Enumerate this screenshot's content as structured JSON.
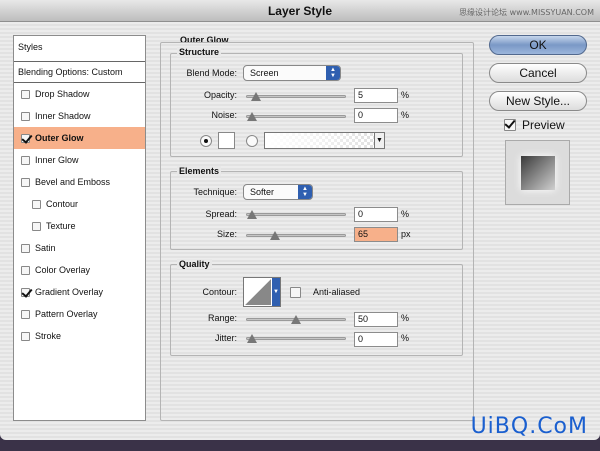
{
  "window": {
    "title": "Layer Style"
  },
  "watermark_top": "思缘设计论坛 www.MISSYUAN.COM",
  "watermark_bottom": "UiBQ.CoM",
  "sidebar": {
    "styles_label": "Styles",
    "blending_label": "Blending Options: Custom",
    "items": [
      {
        "label": "Drop Shadow",
        "checked": false
      },
      {
        "label": "Inner Shadow",
        "checked": false
      },
      {
        "label": "Outer Glow",
        "checked": true,
        "selected": true
      },
      {
        "label": "Inner Glow",
        "checked": false
      },
      {
        "label": "Bevel and Emboss",
        "checked": false
      },
      {
        "label": "Contour",
        "checked": false,
        "indent": true
      },
      {
        "label": "Texture",
        "checked": false,
        "indent": true
      },
      {
        "label": "Satin",
        "checked": false
      },
      {
        "label": "Color Overlay",
        "checked": false
      },
      {
        "label": "Gradient Overlay",
        "checked": true
      },
      {
        "label": "Pattern Overlay",
        "checked": false
      },
      {
        "label": "Stroke",
        "checked": false
      }
    ]
  },
  "panel": {
    "title": "Outer Glow",
    "structure": {
      "label": "Structure",
      "blend_mode_label": "Blend Mode:",
      "blend_mode_value": "Screen",
      "opacity_label": "Opacity:",
      "opacity_value": "5",
      "opacity_level": 0.05,
      "noise_label": "Noise:",
      "noise_value": "0",
      "noise_level": 0,
      "unit": "%"
    },
    "elements": {
      "label": "Elements",
      "technique_label": "Technique:",
      "technique_value": "Softer",
      "spread_label": "Spread:",
      "spread_value": "0",
      "spread_level": 0,
      "spread_unit": "%",
      "size_label": "Size:",
      "size_value": "65",
      "size_level": 0.26,
      "size_unit": "px"
    },
    "quality": {
      "label": "Quality",
      "contour_label": "Contour:",
      "antialiased_label": "Anti-aliased",
      "range_label": "Range:",
      "range_value": "50",
      "range_level": 0.5,
      "jitter_label": "Jitter:",
      "jitter_value": "0",
      "jitter_level": 0,
      "unit": "%"
    }
  },
  "buttons": {
    "ok": "OK",
    "cancel": "Cancel",
    "new_style": "New Style...",
    "preview_label": "Preview",
    "preview_checked": true
  }
}
